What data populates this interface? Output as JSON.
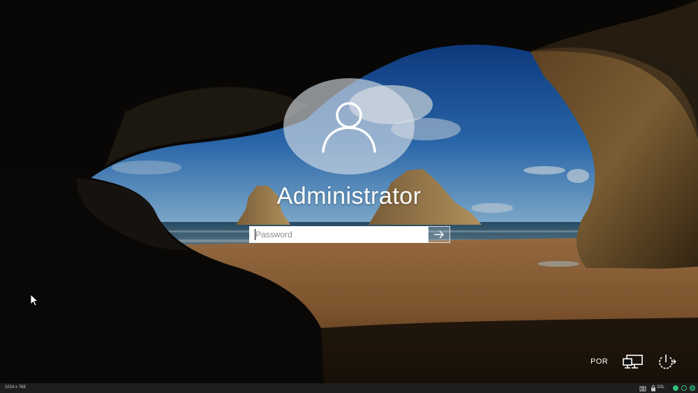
{
  "login": {
    "username": "Administrator",
    "password_placeholder": "Password",
    "password_value": ""
  },
  "tray": {
    "language": "POR"
  },
  "statusbar": {
    "resolution": "1024 x 768",
    "ssl_label": "SSL"
  },
  "icons": {
    "avatar": "user-icon",
    "submit": "arrow-right-icon",
    "network": "network-icon",
    "power": "power-icon"
  },
  "colors": {
    "sky": "#2f6fb6",
    "sand": "#9a6a3a",
    "status_green": "#2ec27e"
  }
}
